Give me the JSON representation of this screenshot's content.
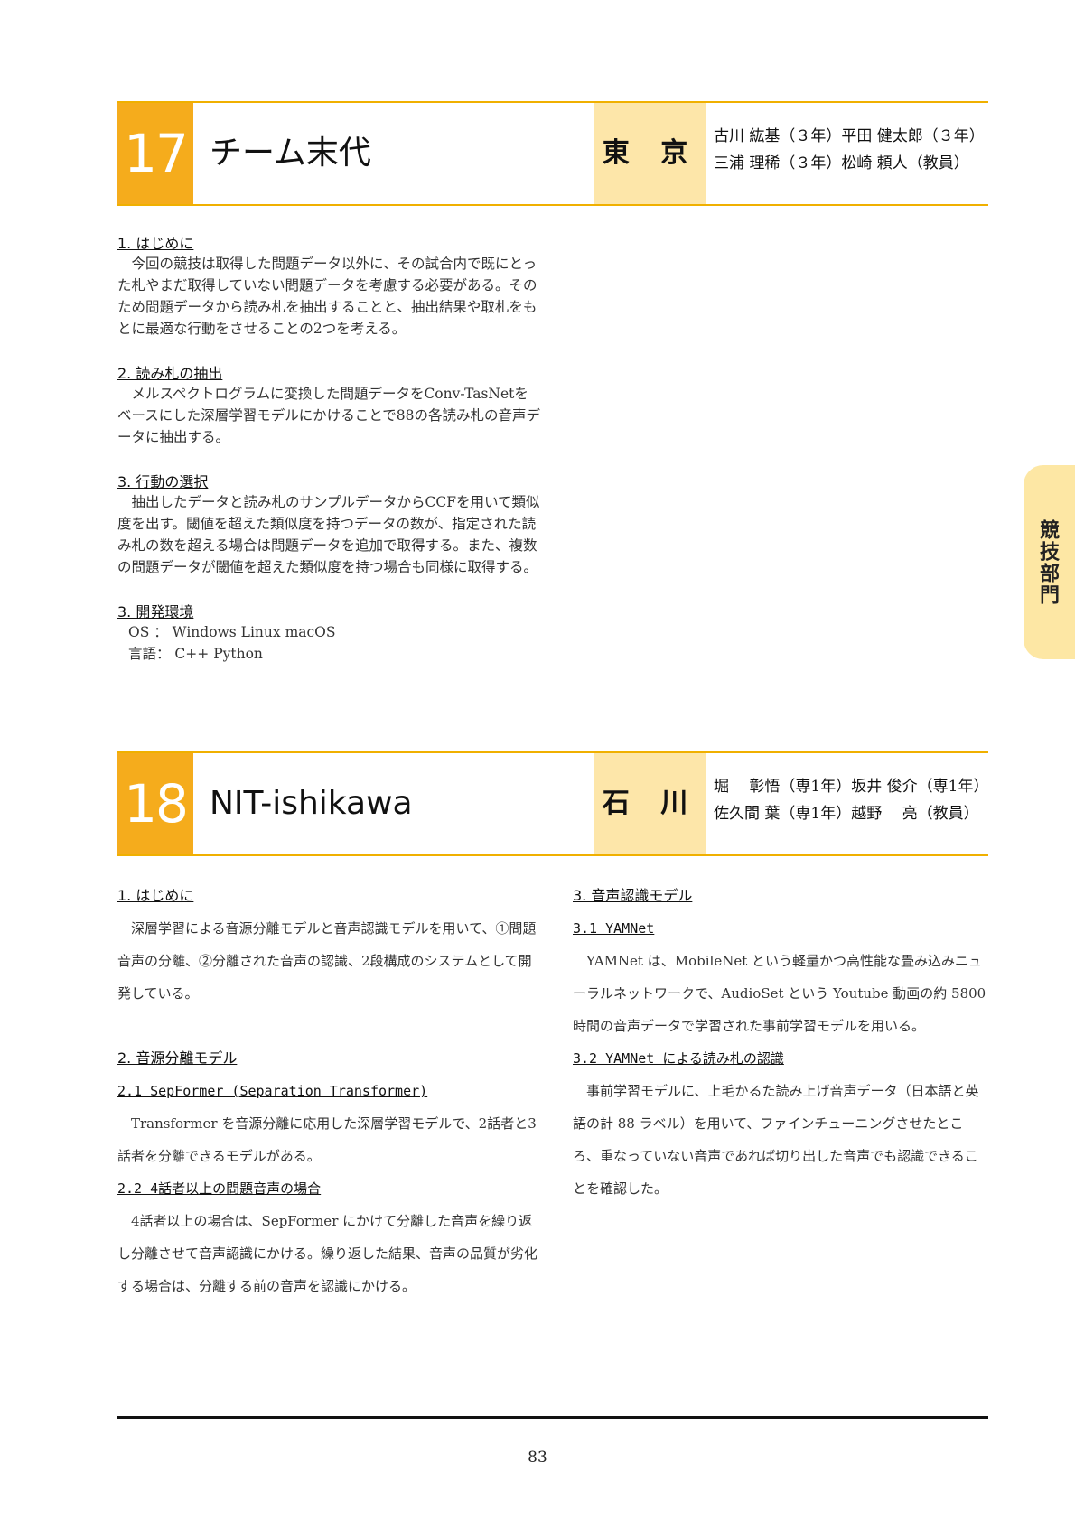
{
  "entry17": {
    "number": "17",
    "team": "チーム末代",
    "prefecture": "東 京",
    "members": [
      "古川 紘基（３年）平田 健太郎（３年）",
      "三浦 理稀（３年）松崎 頼人（教員）"
    ],
    "sections": [
      {
        "title": "1. はじめに",
        "text": "今回の競技は取得した問題データ以外に、その試合内で既にとった札やまだ取得していない問題データを考慮する必要がある。そのため問題データから読み札を抽出することと、抽出結果や取札をもとに最適な行動をさせることの2つを考える。"
      },
      {
        "title": "2. 読み札の抽出",
        "text": "メルスペクトログラムに変換した問題データをConv-TasNetをベースにした深層学習モデルにかけることで88の各読み札の音声データに抽出する。"
      },
      {
        "title": "3. 行動の選択",
        "text": "抽出したデータと読み札のサンプルデータからCCFを用いて類似度を出す。閾値を超えた類似度を持つデータの数が、指定された読み札の数を超える場合は問題データを追加で取得する。また、複数の問題データが閾値を超えた類似度を持つ場合も同様に取得する。"
      }
    ],
    "env": {
      "title": "3. 開発環境",
      "os": "OS ： Windows  Linux  macOS",
      "lang": "言語： C++  Python"
    }
  },
  "entry18": {
    "number": "18",
    "team": "NIT-ishikawa",
    "prefecture": "石 川",
    "members": [
      "堀　 彰悟（専1年）坂井 俊介（専1年）",
      "佐久間 葉（専1年）越野　 亮（教員）"
    ],
    "left": {
      "s1_title": "1. はじめに",
      "s1_text": "深層学習による音源分離モデルと音声認識モデルを用いて、①問題音声の分離、②分離された音声の認識、2段構成のシステムとして開発している。",
      "s2_title": "2. 音源分離モデル",
      "s21_title": "2.1 SepFormer (Separation Transformer)",
      "s21_text": "Transformer を音源分離に応用した深層学習モデルで、2話者と3話者を分離できるモデルがある。",
      "s22_title": "2.2 4話者以上の問題音声の場合",
      "s22_text": "4話者以上の場合は、SepFormer にかけて分離した音声を繰り返し分離させて音声認識にかける。繰り返した結果、音声の品質が劣化する場合は、分離する前の音声を認識にかける。"
    },
    "right": {
      "s3_title": "3. 音声認識モデル",
      "s31_title": "3.1 YAMNet",
      "s31_text": "YAMNet は、MobileNet という軽量かつ高性能な畳み込みニューラルネットワークで、AudioSet という Youtube 動画の約 5800 時間の音声データで学習された事前学習モデルを用いる。",
      "s32_title": "3.2 YAMNet による読み札の認識",
      "s32_text": "事前学習モデルに、上毛かるた読み上げ音声データ（日本語と英語の計 88 ラベル）を用いて、ファインチューニングさせたところ、重なっていない音声であれば切り出した音声でも認識できることを確認した。"
    }
  },
  "side_tab": "競技部門",
  "page_number": "83"
}
